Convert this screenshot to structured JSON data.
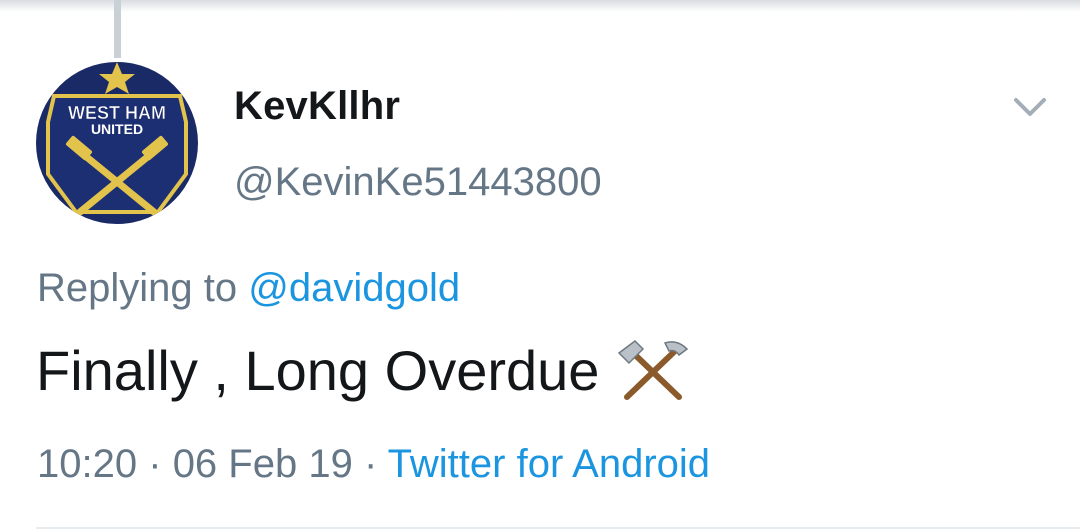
{
  "tweet": {
    "display_name": "KevKllhr",
    "handle": "@KevinKe51443800",
    "replying_prefix": "Replying to",
    "replying_to": "@davidgold",
    "text": "Finally , Long Overdue",
    "emoji_icon": "hammer-and-pick-icon",
    "time": "10:20",
    "date": "06 Feb 19",
    "separator": "·",
    "source": "Twitter for Android"
  },
  "avatar": {
    "crest_line1": "WEST HAM",
    "crest_line2": "UNITED",
    "icon": "west-ham-crest-icon"
  },
  "colors": {
    "text_primary": "#14171a",
    "text_secondary": "#657786",
    "link": "#1b95e0",
    "crest_blue": "#1a2a66",
    "crest_gold": "#e2c34c"
  }
}
